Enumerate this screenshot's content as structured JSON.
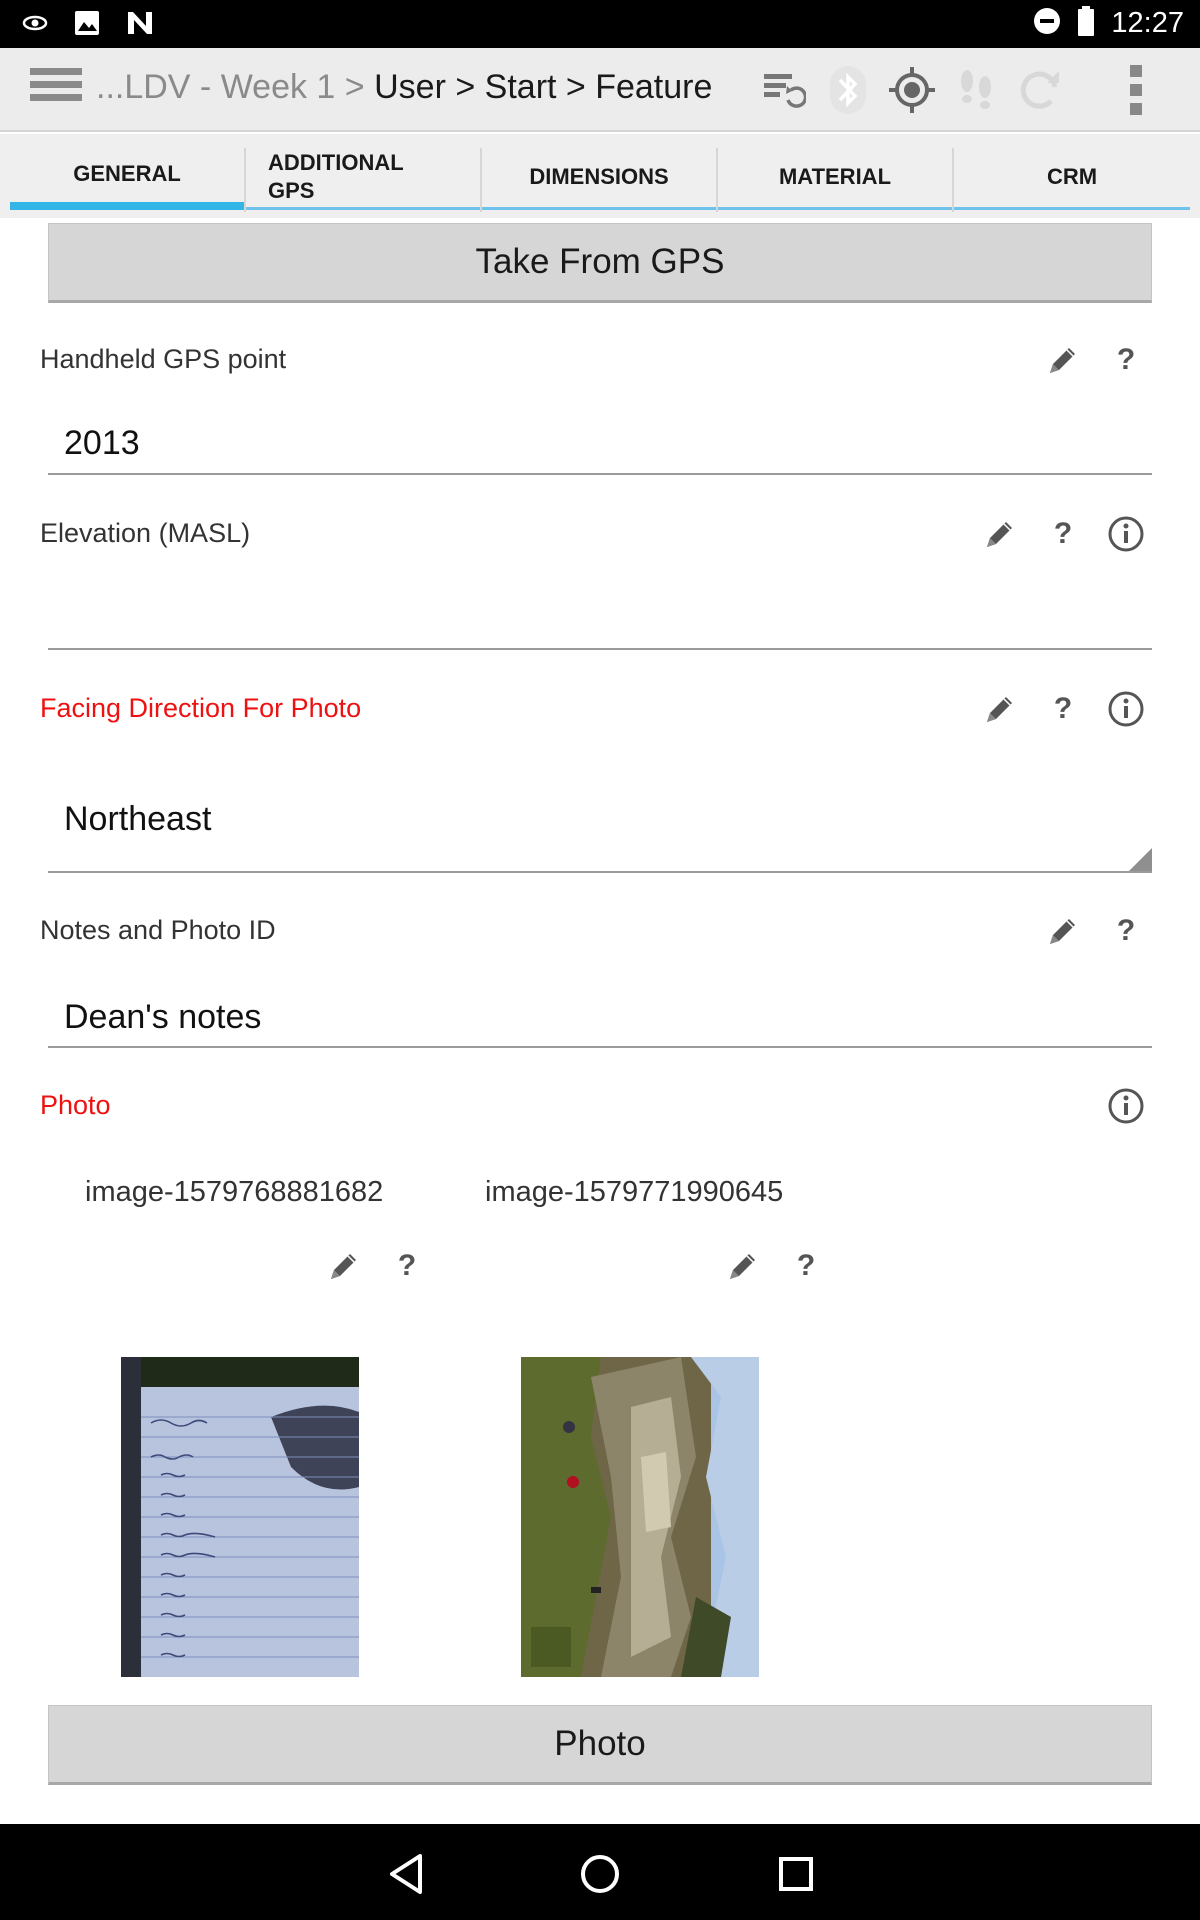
{
  "status_bar": {
    "time": "12:27",
    "icons": [
      "eye-icon",
      "image-icon",
      "n-icon",
      "do-not-disturb-icon",
      "battery-icon"
    ]
  },
  "action_bar": {
    "breadcrumb_prefix": "...LDV - Week 1",
    "sep1": " > ",
    "crumb_user": "User",
    "sep2": " > ",
    "crumb_start": "Start",
    "sep3": " > ",
    "crumb_feature": "Feature",
    "icons": [
      "sync-settings-icon",
      "bluetooth-icon",
      "gps-target-icon",
      "footsteps-icon",
      "refresh-icon",
      "overflow-menu-icon"
    ]
  },
  "tabs": [
    {
      "label": "GENERAL",
      "active": true
    },
    {
      "label": "ADDITIONAL GPS",
      "line1": "ADDITIONAL",
      "line2": "GPS"
    },
    {
      "label": "DIMENSIONS"
    },
    {
      "label": "MATERIAL"
    },
    {
      "label": "CRM"
    }
  ],
  "form": {
    "take_from_gps_label": "Take From GPS",
    "handheld_gps": {
      "label": "Handheld GPS point",
      "value": "2013"
    },
    "elevation": {
      "label": "Elevation (MASL)",
      "value": ""
    },
    "facing_direction": {
      "label": "Facing Direction For Photo",
      "value": "Northeast",
      "required": true
    },
    "notes": {
      "label": "Notes and Photo ID",
      "value": "Dean's notes"
    },
    "photo": {
      "label": "Photo",
      "required": true,
      "images": [
        {
          "caption": "image-1579768881682"
        },
        {
          "caption": "image-1579771990645"
        }
      ],
      "button_label": "Photo"
    },
    "help_symbol": "?"
  },
  "colors": {
    "accent": "#33b5e5",
    "required_label": "#ee1111",
    "button_bg": "#d6d6d6"
  },
  "nav_bar": {
    "icons": [
      "back-icon",
      "home-icon",
      "recents-icon"
    ]
  }
}
